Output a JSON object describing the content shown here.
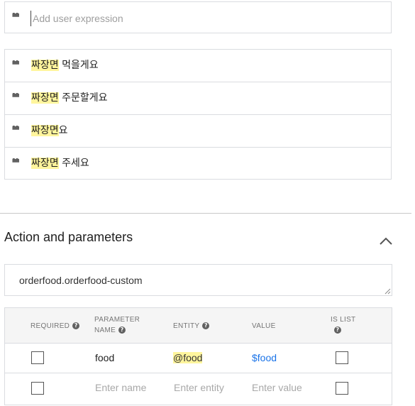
{
  "add_expression": {
    "placeholder": "Add user expression"
  },
  "phrases": [
    {
      "highlight": "짜장면",
      "rest": " 먹을게요"
    },
    {
      "highlight": "짜장면",
      "rest": " 주문할게요"
    },
    {
      "highlight": "짜장면",
      "rest": "요"
    },
    {
      "highlight": "짜장면",
      "rest": " 주세요"
    }
  ],
  "section": {
    "title": "Action and parameters"
  },
  "action": {
    "value": "orderfood.orderfood-custom"
  },
  "params_table": {
    "headers": {
      "required": "REQUIRED",
      "parameter_name_line1": "PARAMETER",
      "parameter_name_line2": "NAME",
      "entity": "ENTITY",
      "value": "VALUE",
      "is_list": "IS LIST"
    },
    "help_glyph": "?",
    "rows": [
      {
        "name": "food",
        "entity": "@food",
        "value": "$food",
        "required": false,
        "is_list": false
      }
    ],
    "new_row": {
      "name_placeholder": "Enter name",
      "entity_placeholder": "Enter entity",
      "value_placeholder": "Enter value"
    }
  },
  "icons": {
    "quote": "format-quote-icon",
    "chevron": "chevron-up-icon",
    "help": "help-circle-icon"
  },
  "colors": {
    "highlight": "#fff59d",
    "link": "#1a73e8",
    "border": "#dadce0"
  }
}
